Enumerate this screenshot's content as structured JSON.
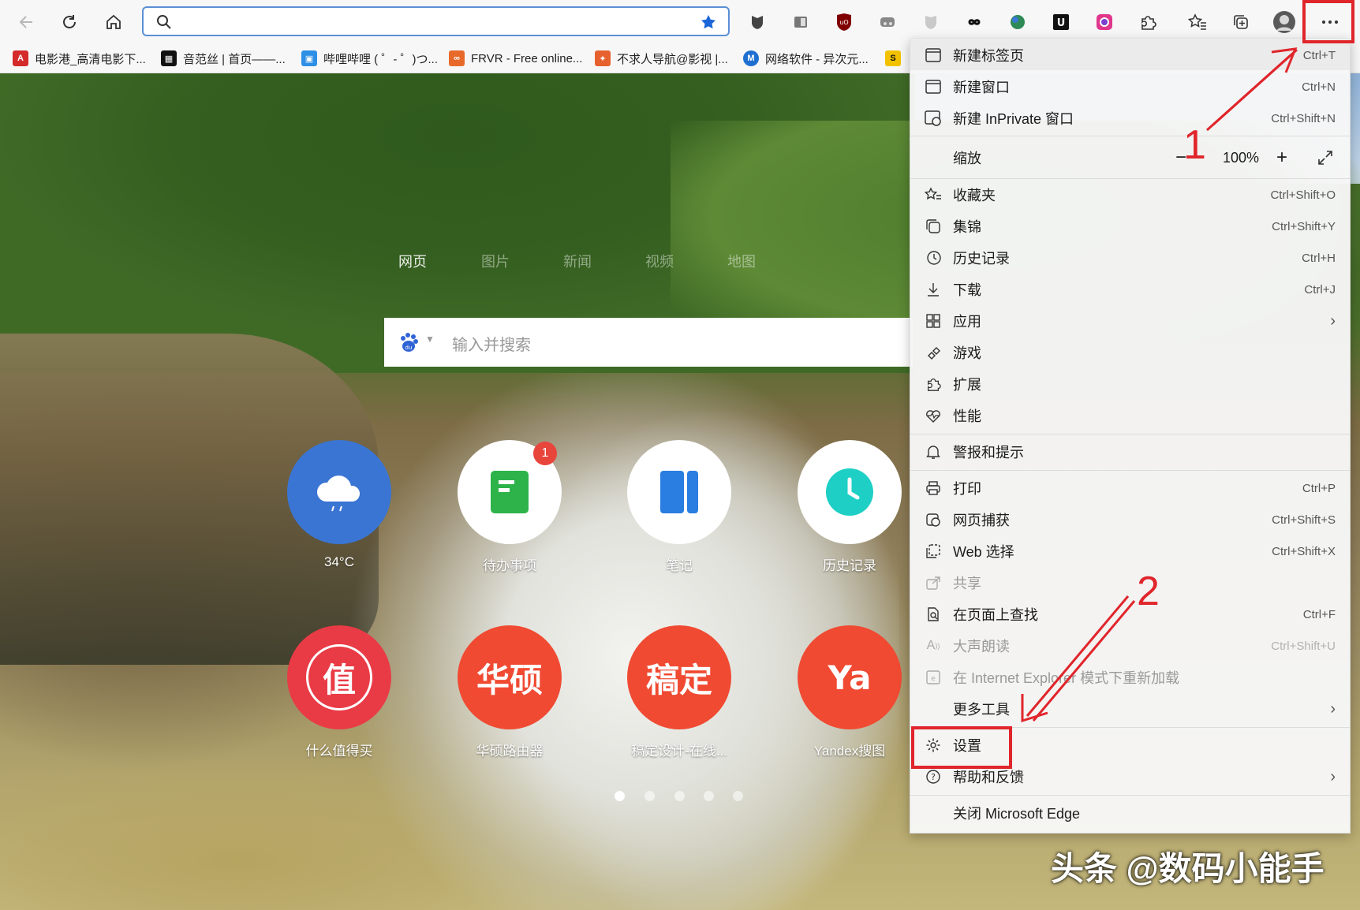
{
  "browser": {
    "address_value": "",
    "zoom_value": "100%",
    "bookmarks": [
      {
        "label": "电影港_高清电影下...",
        "icon": "movie-site-icon",
        "color": "#d42a2a"
      },
      {
        "label": "音范丝 | 首页——...",
        "icon": "grid-logo-icon",
        "color": "#111111"
      },
      {
        "label": "哔哩哔哩 ( ゜- ゜)つ...",
        "icon": "bilibili-icon",
        "color": "#2d8fe5"
      },
      {
        "label": "FRVR - Free online...",
        "icon": "frvr-icon",
        "color": "#e86a2a"
      },
      {
        "label": "不求人导航@影视 |...",
        "icon": "buqiuren-icon",
        "color": "#e7612e"
      },
      {
        "label": "网络软件 - 异次元...",
        "icon": "iplaysoft-icon",
        "color": "#1f6fd1"
      }
    ]
  },
  "newtab": {
    "search_tabs": [
      "网页",
      "图片",
      "新闻",
      "视频",
      "地图"
    ],
    "search_placeholder": "输入并搜索",
    "tiles_row1": [
      {
        "label": "34°C",
        "icon": "weather-icon",
        "color": "#3a75d3"
      },
      {
        "label": "待办事项",
        "icon": "todo-icon",
        "color": "#ffffff",
        "badge": "1"
      },
      {
        "label": "笔记",
        "icon": "notes-icon",
        "color": "#ffffff"
      },
      {
        "label": "历史记录",
        "icon": "history-clock-icon",
        "color": "#ffffff"
      }
    ],
    "tiles_row2": [
      {
        "label": "什么值得买",
        "text": "值",
        "color": "#e93b46"
      },
      {
        "label": "华硕路由器",
        "text": "华硕",
        "color": "#f04a32"
      },
      {
        "label": "稿定设计-在线...",
        "text": "稿定",
        "color": "#f04a32"
      },
      {
        "label": "Yandex搜图",
        "text": "Ya",
        "color": "#f04a32"
      }
    ],
    "page_dots": 5,
    "watermark": "头条 @数码小能手"
  },
  "menu": {
    "items": [
      {
        "label": "新建标签页",
        "shortcut": "Ctrl+T",
        "icon": "new-tab-icon"
      },
      {
        "label": "新建窗口",
        "shortcut": "Ctrl+N",
        "icon": "new-window-icon"
      },
      {
        "label": "新建 InPrivate 窗口",
        "shortcut": "Ctrl+Shift+N",
        "icon": "inprivate-icon"
      },
      {
        "label": "缩放",
        "shortcut": "",
        "icon": ""
      },
      {
        "label": "收藏夹",
        "shortcut": "Ctrl+Shift+O",
        "icon": "favorites-icon"
      },
      {
        "label": "集锦",
        "shortcut": "Ctrl+Shift+Y",
        "icon": "collections-icon"
      },
      {
        "label": "历史记录",
        "shortcut": "Ctrl+H",
        "icon": "history-icon"
      },
      {
        "label": "下载",
        "shortcut": "Ctrl+J",
        "icon": "download-icon"
      },
      {
        "label": "应用",
        "shortcut": "",
        "icon": "apps-icon"
      },
      {
        "label": "游戏",
        "shortcut": "",
        "icon": "games-icon"
      },
      {
        "label": "扩展",
        "shortcut": "",
        "icon": "extensions-icon"
      },
      {
        "label": "性能",
        "shortcut": "",
        "icon": "performance-icon"
      },
      {
        "label": "警报和提示",
        "shortcut": "",
        "icon": "bell-icon"
      },
      {
        "label": "打印",
        "shortcut": "Ctrl+P",
        "icon": "print-icon"
      },
      {
        "label": "网页捕获",
        "shortcut": "Ctrl+Shift+S",
        "icon": "capture-icon"
      },
      {
        "label": "Web 选择",
        "shortcut": "Ctrl+Shift+X",
        "icon": "web-select-icon"
      },
      {
        "label": "共享",
        "shortcut": "",
        "icon": "share-icon"
      },
      {
        "label": "在页面上查找",
        "shortcut": "Ctrl+F",
        "icon": "find-icon"
      },
      {
        "label": "大声朗读",
        "shortcut": "Ctrl+Shift+U",
        "icon": "read-aloud-icon"
      },
      {
        "label": "在 Internet Explorer 模式下重新加载",
        "shortcut": "",
        "icon": "ie-mode-icon"
      },
      {
        "label": "更多工具",
        "shortcut": "",
        "icon": ""
      },
      {
        "label": "设置",
        "shortcut": "",
        "icon": "gear-icon"
      },
      {
        "label": "帮助和反馈",
        "shortcut": "",
        "icon": "help-icon"
      },
      {
        "label": "关闭 Microsoft Edge",
        "shortcut": "",
        "icon": ""
      }
    ]
  },
  "annotations": {
    "step1": "1",
    "step2": "2",
    "color": "#e0252b"
  }
}
